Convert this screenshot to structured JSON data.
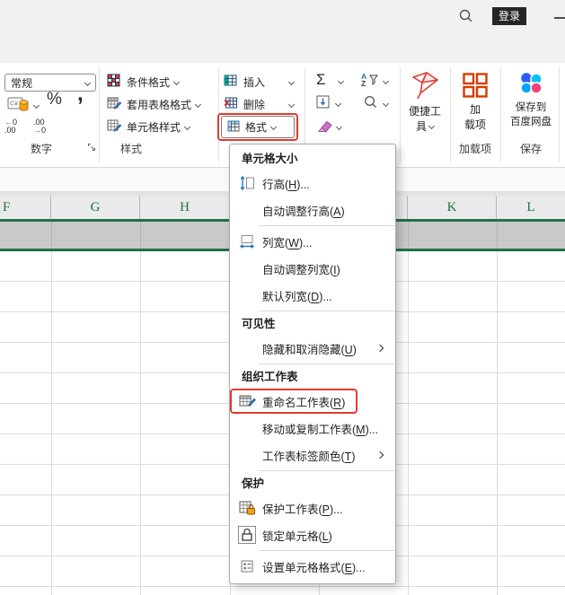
{
  "topbar": {
    "login": "登录"
  },
  "ribbon": {
    "number": {
      "group_label": "数字",
      "format_value": "常规",
      "percent": "%",
      "comma": ",",
      "dec": {
        "arrow": "←",
        "zero": "0",
        "line2": ".00"
      },
      "inc": {
        "line1": ".00",
        "arrow": "→",
        "zero": "0"
      }
    },
    "styles": {
      "group_label": "样式",
      "cond": "条件格式",
      "table_style": "套用表格格式",
      "cell_style": "单元格样式"
    },
    "cells": {
      "insert": "插入",
      "del": "删除",
      "format": "格式"
    },
    "editing": {
      "sigma": "Σ"
    },
    "tools": {
      "line1": "便捷工",
      "line2": "具"
    },
    "addins": {
      "group_label": "加载项",
      "line1": "加",
      "line2": "载项"
    },
    "save": {
      "group_label": "保存",
      "line1": "保存到",
      "line2": "百度网盘"
    }
  },
  "sheet": {
    "cols": [
      "F",
      "G",
      "H",
      "K",
      "L"
    ]
  },
  "menu": {
    "s0_header": "单元格大小",
    "row_height": {
      "pre": "行高(",
      "key": "H",
      "post": ")..."
    },
    "autofit_row": {
      "pre": "自动调整行高(",
      "key": "A",
      "post": ")"
    },
    "col_width": {
      "pre": "列宽(",
      "key": "W",
      "post": ")..."
    },
    "autofit_col": {
      "pre": "自动调整列宽(",
      "key": "I",
      "post": ")"
    },
    "default_width": {
      "pre": "默认列宽(",
      "key": "D",
      "post": ")..."
    },
    "s1_header": "可见性",
    "hide_unhide": {
      "pre": "隐藏和取消隐藏(",
      "key": "U",
      "post": ")"
    },
    "s2_header": "组织工作表",
    "rename": {
      "pre": "重命名工作表(",
      "key": "R",
      "post": ")"
    },
    "move_copy": {
      "pre": "移动或复制工作表(",
      "key": "M",
      "post": ")..."
    },
    "tab_color": {
      "pre": "工作表标签颜色(",
      "key": "T",
      "post": ")"
    },
    "s3_header": "保护",
    "protect": {
      "pre": "保护工作表(",
      "key": "P",
      "post": ")..."
    },
    "lock": {
      "pre": "锁定单元格(",
      "key": "L",
      "post": ")"
    },
    "format_cells": {
      "pre": "设置单元格格式(",
      "key": "E",
      "post": ")..."
    }
  },
  "colors": {
    "excel_green": "#217346",
    "annotation_red": "#e23a2e",
    "login_bg": "#262626",
    "header_text_green": "#1e7145"
  }
}
